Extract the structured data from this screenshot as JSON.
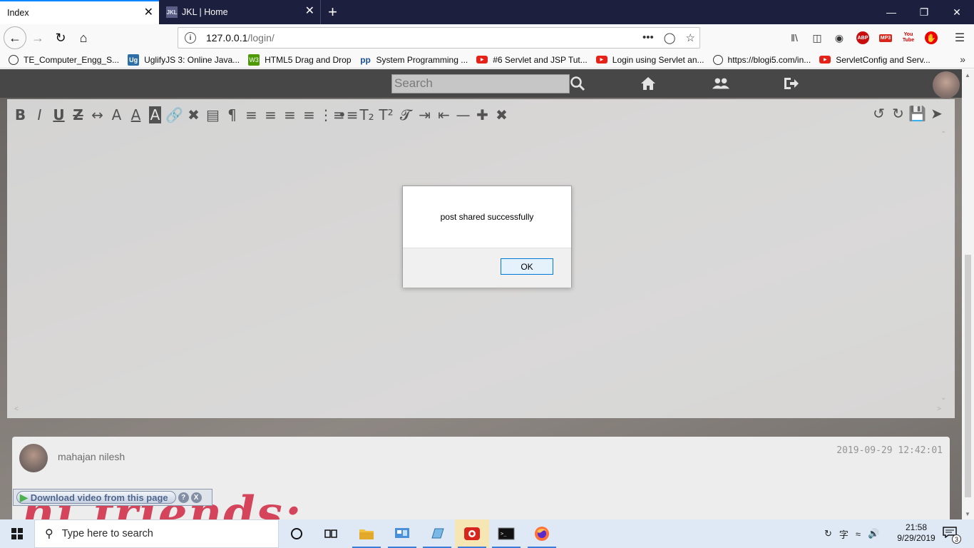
{
  "browser": {
    "tabs": [
      {
        "label": "Index",
        "favicon": ""
      },
      {
        "label": "JKL | Home",
        "favicon": "JKL"
      }
    ],
    "url": {
      "host": "127.0.0.1",
      "path": "/login/"
    },
    "bookmarks": [
      {
        "label": "TE_Computer_Engg_S...",
        "icon": "globe-icon"
      },
      {
        "label": "UglifyJS 3: Online Java...",
        "icon": "uglify-icon"
      },
      {
        "label": "HTML5 Drag and Drop",
        "icon": "html5-icon"
      },
      {
        "label": "System Programming ...",
        "icon": "pp-icon"
      },
      {
        "label": "#6 Servlet and JSP Tut...",
        "icon": "youtube-icon"
      },
      {
        "label": "Login using Servlet an...",
        "icon": "youtube-icon"
      },
      {
        "label": "https://blogi5.com/in...",
        "icon": "globe-icon"
      },
      {
        "label": "ServletConfig and Serv...",
        "icon": "youtube-icon"
      }
    ],
    "toolbar_badges": {
      "abp": "ABP",
      "mp3": "MP3",
      "youtube": "You Tube"
    }
  },
  "site": {
    "search_placeholder": "Search",
    "post": {
      "username": "mahajan nilesh",
      "timestamp": "2019-09-29 12:42:01",
      "content": "hi friends:"
    },
    "download_bar": {
      "label": "Download video from this page",
      "help": "?",
      "close": "X"
    }
  },
  "dialog": {
    "message": "post shared successfully",
    "ok_label": "OK"
  },
  "taskbar": {
    "search_placeholder": "Type here to search",
    "time": "21:58",
    "date": "9/29/2019",
    "notifications": "3"
  },
  "colors": {
    "tabstrip": "#1d1f3e",
    "accent": "#0a84ff",
    "post_text": "#c8102e",
    "taskbar": "#dfe9f5"
  }
}
